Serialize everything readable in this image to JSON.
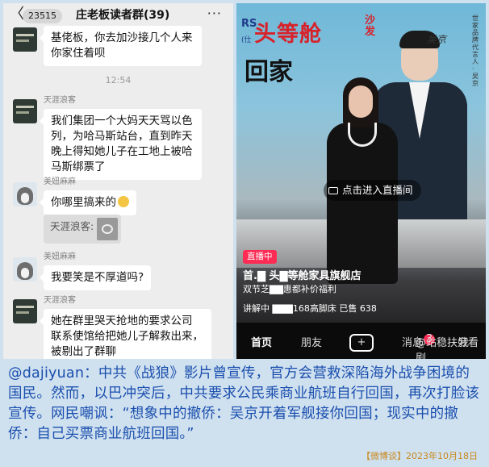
{
  "chat": {
    "header": {
      "back": "〈",
      "badge": "23515",
      "title": "庄老板读者群(39)",
      "more": "···"
    },
    "messages": [
      {
        "type": "text",
        "avatar": "dark",
        "text": [
          "基佬板，你去加沙接几个人来",
          "你家住着呗"
        ]
      },
      {
        "type": "time",
        "text": "12:54"
      },
      {
        "type": "text",
        "avatar": "dark",
        "sender": "天涯浪客",
        "text": [
          "我们集团一个大妈天天骂以色",
          "列，为哈马斯站台，直到昨天",
          "晚上得知她儿子在工地上被哈",
          "马斯绑票了"
        ]
      },
      {
        "type": "text",
        "avatar": "dog",
        "sender": "美妞麻麻",
        "text": [
          "你哪里搞来的"
        ]
      },
      {
        "type": "quote",
        "text": "天涯浪客:"
      },
      {
        "type": "text",
        "avatar": "dog",
        "sender": "美妞麻麻",
        "text": [
          "我要笑是不厚道吗?"
        ]
      },
      {
        "type": "text",
        "avatar": "dark",
        "sender": "天涯浪客",
        "text": [
          "她在群里哭天抢地的要求公司",
          "联系使馆给把她儿子解救出来，",
          "被剔出了群聊"
        ]
      }
    ]
  },
  "live": {
    "brand_left": "RS",
    "brand_left_sub": "(仕",
    "banner_title": "头等舱",
    "banner_sofa": "沙发",
    "banner_home": "回家",
    "signature": "吴京",
    "vertical_text": "世家品牌代言人·吴京",
    "enter_label": "点击进入直播间",
    "live_tag": "直播中",
    "shop_name": "首.▇ 头▇等舱家具旗舰店",
    "shop_desc": "双节芝▇▇惠都补价福利",
    "cart": "讲解中  ▇▇▇168高脚床  已售 638",
    "nav": {
      "home": "首页",
      "friends": "朋友",
      "plus": "+",
      "messages": "消息",
      "msg_count": "3",
      "me": "我"
    },
    "watermark": "@站稳扶好看剧"
  },
  "caption": {
    "text": "@dajiyuan：中共《战狼》影片曾宣传，官方会营救深陷海外战争困境的国民。然而，以巴冲突后，中共要求公民乘商业航班自行回国，再次打脸该宣传。网民嘲讽：“想象中的撤侨：吴京开着军舰接你回国；现实中的撤侨：自己买票商业航班回国。”",
    "source": "【微博谈】2023年10月18日"
  }
}
